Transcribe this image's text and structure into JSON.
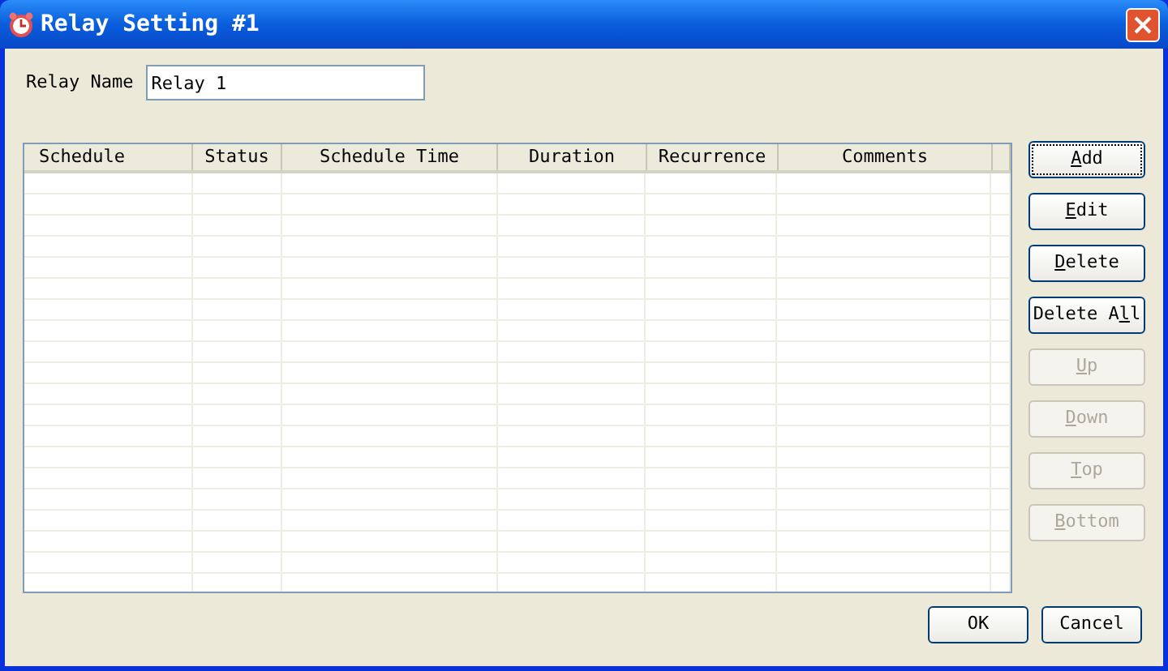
{
  "window": {
    "title": "Relay Setting #1"
  },
  "relay_name": {
    "label": "Relay Name",
    "value": "Relay 1"
  },
  "table": {
    "columns": [
      "Schedule",
      "Status",
      "Schedule Time",
      "Duration",
      "Recurrence",
      "Comments"
    ]
  },
  "side_buttons": [
    {
      "key": "A",
      "after": "dd",
      "disabled": false,
      "focused": true
    },
    {
      "key": "E",
      "after": "dit",
      "disabled": false,
      "focused": false
    },
    {
      "key": "D",
      "after": "elete",
      "disabled": false,
      "focused": false
    },
    {
      "before": "Delete A",
      "key": "l",
      "after": "l",
      "disabled": false,
      "focused": false
    },
    {
      "key": "U",
      "after": "p",
      "disabled": true,
      "focused": false
    },
    {
      "key": "D",
      "after": "own",
      "disabled": true,
      "focused": false
    },
    {
      "key": "T",
      "after": "op",
      "disabled": true,
      "focused": false
    },
    {
      "key": "B",
      "after": "ottom",
      "disabled": true,
      "focused": false
    }
  ],
  "footer_buttons": [
    {
      "label": "OK"
    },
    {
      "label": "Cancel"
    }
  ]
}
